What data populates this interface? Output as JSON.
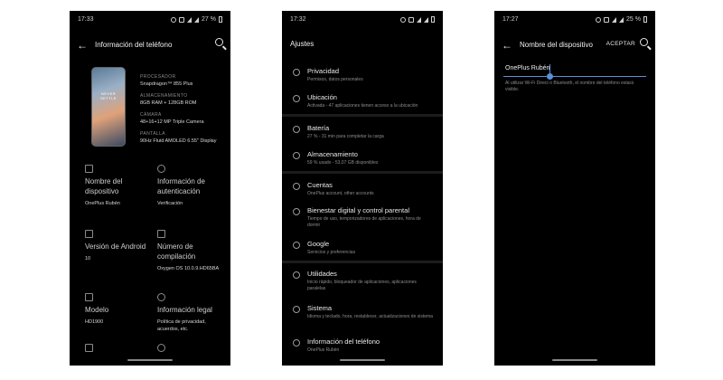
{
  "screens": [
    {
      "status": {
        "time": "17:33",
        "battery": "27 %"
      },
      "title": "Información del teléfono",
      "phone_image_text": "NEVER SETTLE",
      "specs": [
        {
          "label": "PROCESADOR",
          "value": "Snapdragon™ 855 Plus"
        },
        {
          "label": "ALMACENAMIENTO",
          "value": "8GB RAM + 128GB ROM"
        },
        {
          "label": "CÁMARA",
          "value": "48+16+12 MP Triple Camera"
        },
        {
          "label": "PANTALLA",
          "value": "90Hz Fluid AMOLED 6.55\" Display"
        }
      ],
      "tiles": [
        {
          "icon": "phone-icon",
          "title": "Nombre del dispositivo",
          "detail": "OnePlus Rubén"
        },
        {
          "icon": "star-icon",
          "title": "Información de autenticación",
          "detail": "Verificación"
        },
        {
          "icon": "android-icon",
          "title": "Versión de Android",
          "detail": "10"
        },
        {
          "icon": "layers-icon",
          "title": "Número de compilación",
          "detail": "Oxygen OS 10.0.9.HD65BA"
        },
        {
          "icon": "cube-icon",
          "title": "Modelo",
          "detail": "HD1900"
        },
        {
          "icon": "copyright-icon",
          "title": "Información legal",
          "detail": "Política de privacidad, acuerdos, etc."
        }
      ]
    },
    {
      "status": {
        "time": "17:32"
      },
      "title": "Ajustes",
      "items": [
        {
          "icon": "privacy-icon",
          "title": "Privacidad",
          "subtitle": "Permisos, datos personales"
        },
        {
          "icon": "location-icon",
          "title": "Ubicación",
          "subtitle": "Activada - 47 aplicaciones tienen acceso a la ubicación"
        },
        {
          "icon": "battery-icon",
          "title": "Batería",
          "subtitle": "27 % - 31 min para completar la carga"
        },
        {
          "icon": "storage-icon",
          "title": "Almacenamiento",
          "subtitle": "59 % usado - 53,07 GB disponibles"
        },
        {
          "icon": "accounts-icon",
          "title": "Cuentas",
          "subtitle": "OnePlus account, other accounts"
        },
        {
          "icon": "wellbeing-icon",
          "title": "Bienestar digital y control parental",
          "subtitle": "Tiempo de uso, temporizadores de aplicaciones, hora de dormir"
        },
        {
          "icon": "google-icon",
          "title": "Google",
          "subtitle": "Servicios y preferencias"
        },
        {
          "icon": "utilities-icon",
          "title": "Utilidades",
          "subtitle": "Inicio rápido, bloqueador de aplicaciones, aplicaciones paralelas"
        },
        {
          "icon": "system-icon",
          "title": "Sistema",
          "subtitle": "Idioma y teclado, hora, restablecer, actualizaciones de sistema"
        },
        {
          "icon": "info-icon",
          "title": "Información del teléfono",
          "subtitle": "OnePlus Rubén"
        }
      ]
    },
    {
      "status": {
        "time": "17:27",
        "battery": "25 %"
      },
      "title": "Nombre del dispositivo",
      "accept": "ACEPTAR",
      "field_value": "OnePlus Rubén",
      "help": "Al utilizar Wi-Fi Direct o Bluetooth, el nombre del teléfono estará visible."
    }
  ]
}
